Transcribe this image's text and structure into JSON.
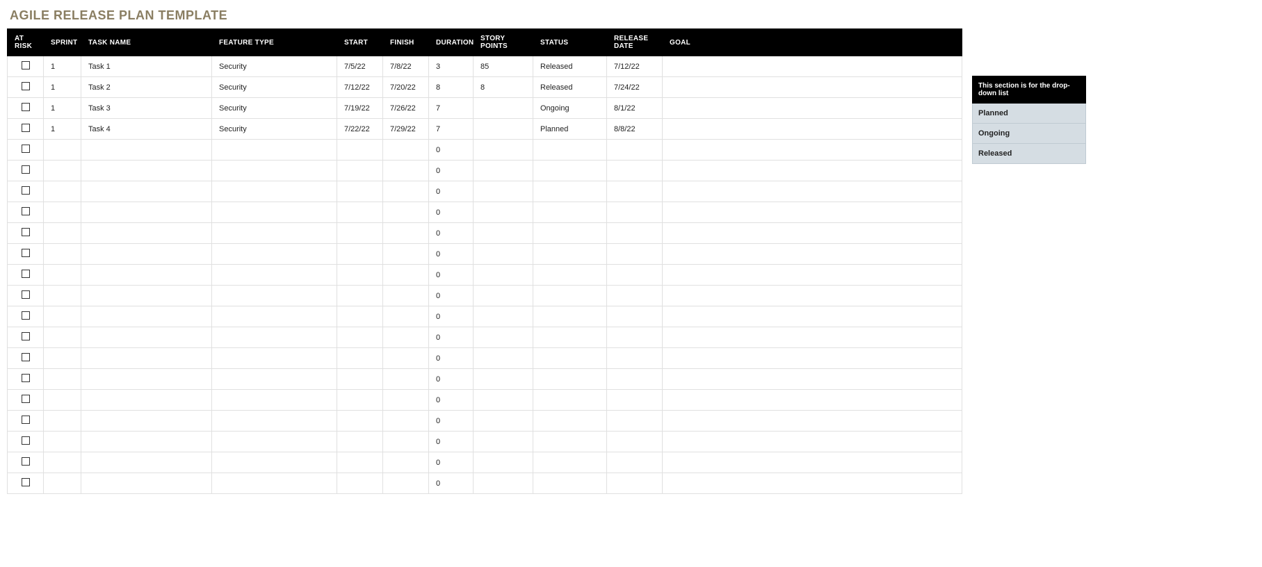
{
  "title": "AGILE RELEASE PLAN TEMPLATE",
  "columns": {
    "at_risk": "AT RISK",
    "sprint": "SPRINT",
    "task_name": "TASK NAME",
    "feature_type": "FEATURE TYPE",
    "start": "START",
    "finish": "FINISH",
    "duration": "DURATION",
    "story_points": "STORY POINTS",
    "status": "STATUS",
    "release_date": "RELEASE DATE",
    "goal": "GOAL"
  },
  "rows": [
    {
      "at_risk": false,
      "sprint": "1",
      "task_name": "Task 1",
      "feature_type": "Security",
      "start": "7/5/22",
      "finish": "7/8/22",
      "duration": "3",
      "story_points": "85",
      "status": "Released",
      "release_date": "7/12/22",
      "goal": ""
    },
    {
      "at_risk": false,
      "sprint": "1",
      "task_name": "Task 2",
      "feature_type": "Security",
      "start": "7/12/22",
      "finish": "7/20/22",
      "duration": "8",
      "story_points": "8",
      "status": "Released",
      "release_date": "7/24/22",
      "goal": ""
    },
    {
      "at_risk": false,
      "sprint": "1",
      "task_name": "Task 3",
      "feature_type": "Security",
      "start": "7/19/22",
      "finish": "7/26/22",
      "duration": "7",
      "story_points": "",
      "status": "Ongoing",
      "release_date": "8/1/22",
      "goal": ""
    },
    {
      "at_risk": false,
      "sprint": "1",
      "task_name": "Task 4",
      "feature_type": "Security",
      "start": "7/22/22",
      "finish": "7/29/22",
      "duration": "7",
      "story_points": "",
      "status": "Planned",
      "release_date": "8/8/22",
      "goal": ""
    },
    {
      "at_risk": false,
      "sprint": "",
      "task_name": "",
      "feature_type": "",
      "start": "",
      "finish": "",
      "duration": "0",
      "story_points": "",
      "status": "",
      "release_date": "",
      "goal": ""
    },
    {
      "at_risk": false,
      "sprint": "",
      "task_name": "",
      "feature_type": "",
      "start": "",
      "finish": "",
      "duration": "0",
      "story_points": "",
      "status": "",
      "release_date": "",
      "goal": ""
    },
    {
      "at_risk": false,
      "sprint": "",
      "task_name": "",
      "feature_type": "",
      "start": "",
      "finish": "",
      "duration": "0",
      "story_points": "",
      "status": "",
      "release_date": "",
      "goal": ""
    },
    {
      "at_risk": false,
      "sprint": "",
      "task_name": "",
      "feature_type": "",
      "start": "",
      "finish": "",
      "duration": "0",
      "story_points": "",
      "status": "",
      "release_date": "",
      "goal": ""
    },
    {
      "at_risk": false,
      "sprint": "",
      "task_name": "",
      "feature_type": "",
      "start": "",
      "finish": "",
      "duration": "0",
      "story_points": "",
      "status": "",
      "release_date": "",
      "goal": ""
    },
    {
      "at_risk": false,
      "sprint": "",
      "task_name": "",
      "feature_type": "",
      "start": "",
      "finish": "",
      "duration": "0",
      "story_points": "",
      "status": "",
      "release_date": "",
      "goal": ""
    },
    {
      "at_risk": false,
      "sprint": "",
      "task_name": "",
      "feature_type": "",
      "start": "",
      "finish": "",
      "duration": "0",
      "story_points": "",
      "status": "",
      "release_date": "",
      "goal": ""
    },
    {
      "at_risk": false,
      "sprint": "",
      "task_name": "",
      "feature_type": "",
      "start": "",
      "finish": "",
      "duration": "0",
      "story_points": "",
      "status": "",
      "release_date": "",
      "goal": ""
    },
    {
      "at_risk": false,
      "sprint": "",
      "task_name": "",
      "feature_type": "",
      "start": "",
      "finish": "",
      "duration": "0",
      "story_points": "",
      "status": "",
      "release_date": "",
      "goal": ""
    },
    {
      "at_risk": false,
      "sprint": "",
      "task_name": "",
      "feature_type": "",
      "start": "",
      "finish": "",
      "duration": "0",
      "story_points": "",
      "status": "",
      "release_date": "",
      "goal": ""
    },
    {
      "at_risk": false,
      "sprint": "",
      "task_name": "",
      "feature_type": "",
      "start": "",
      "finish": "",
      "duration": "0",
      "story_points": "",
      "status": "",
      "release_date": "",
      "goal": ""
    },
    {
      "at_risk": false,
      "sprint": "",
      "task_name": "",
      "feature_type": "",
      "start": "",
      "finish": "",
      "duration": "0",
      "story_points": "",
      "status": "",
      "release_date": "",
      "goal": ""
    },
    {
      "at_risk": false,
      "sprint": "",
      "task_name": "",
      "feature_type": "",
      "start": "",
      "finish": "",
      "duration": "0",
      "story_points": "",
      "status": "",
      "release_date": "",
      "goal": ""
    },
    {
      "at_risk": false,
      "sprint": "",
      "task_name": "",
      "feature_type": "",
      "start": "",
      "finish": "",
      "duration": "0",
      "story_points": "",
      "status": "",
      "release_date": "",
      "goal": ""
    },
    {
      "at_risk": false,
      "sprint": "",
      "task_name": "",
      "feature_type": "",
      "start": "",
      "finish": "",
      "duration": "0",
      "story_points": "",
      "status": "",
      "release_date": "",
      "goal": ""
    },
    {
      "at_risk": false,
      "sprint": "",
      "task_name": "",
      "feature_type": "",
      "start": "",
      "finish": "",
      "duration": "0",
      "story_points": "",
      "status": "",
      "release_date": "",
      "goal": ""
    },
    {
      "at_risk": false,
      "sprint": "",
      "task_name": "",
      "feature_type": "",
      "start": "",
      "finish": "",
      "duration": "0",
      "story_points": "",
      "status": "",
      "release_date": "",
      "goal": ""
    }
  ],
  "dropdown": {
    "header": "This section is for the drop-down list",
    "items": [
      "Planned",
      "Ongoing",
      "Released"
    ]
  }
}
